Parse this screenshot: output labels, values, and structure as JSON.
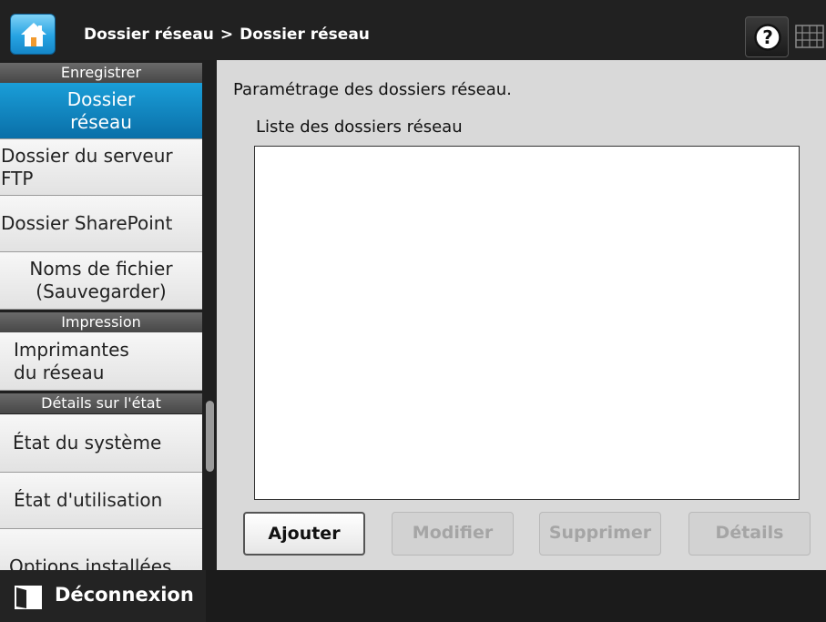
{
  "header": {
    "breadcrumb_parent": "Dossier réseau",
    "breadcrumb_separator": ">",
    "breadcrumb_current": "Dossier réseau",
    "home_icon": "home-icon",
    "help_icon": "help-icon",
    "keyboard_icon": "keyboard-icon"
  },
  "sidebar": {
    "sections": {
      "save": "Enregistrer",
      "print": "Impression",
      "status": "Détails sur l'état"
    },
    "items": [
      {
        "line1": "Dossier",
        "line2": "réseau",
        "active": true
      },
      {
        "line1": "Dossier du serveur",
        "line2": "FTP"
      },
      {
        "line1": "Dossier SharePoint"
      },
      {
        "line1": "Noms de fichier",
        "line2": "(Sauvegarder)"
      },
      {
        "line1": "Imprimantes",
        "line2": "du réseau"
      },
      {
        "line1": "État du système"
      },
      {
        "line1": "État d'utilisation"
      },
      {
        "line1": "Options installées"
      }
    ]
  },
  "main": {
    "description": "Paramétrage des dossiers réseau.",
    "list_label": "Liste des dossiers réseau",
    "list_items": [],
    "buttons": {
      "add": "Ajouter",
      "modify": "Modifier",
      "delete": "Supprimer",
      "details": "Détails"
    }
  },
  "footer": {
    "logout_label": "Déconnexion",
    "logout_icon": "logout-icon"
  },
  "colors": {
    "accent": "#0a8fcf",
    "header_bg": "#212121",
    "panel_bg": "#d9d9d9"
  }
}
